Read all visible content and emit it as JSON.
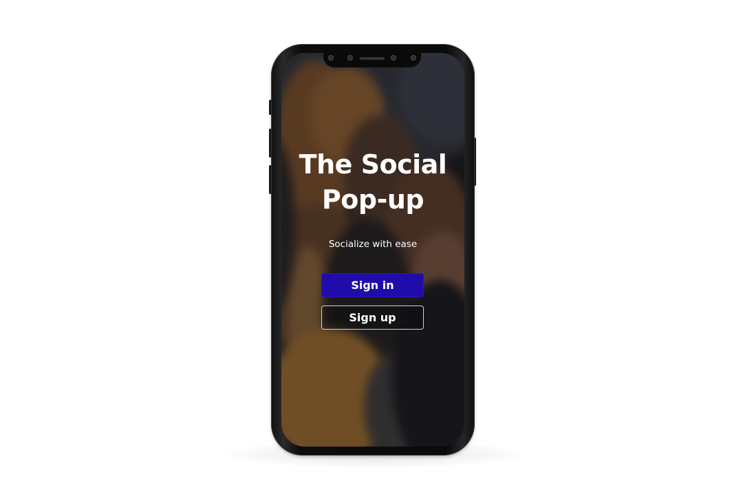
{
  "app": {
    "title_line1": "The Social",
    "title_line2": "Pop-up",
    "tagline": "Socialize with ease"
  },
  "actions": {
    "sign_in_label": "Sign in",
    "sign_up_label": "Sign up"
  },
  "colors": {
    "primary_button": "#200cab",
    "text": "#ffffff",
    "outline_button_border": "#d4d4d4"
  }
}
